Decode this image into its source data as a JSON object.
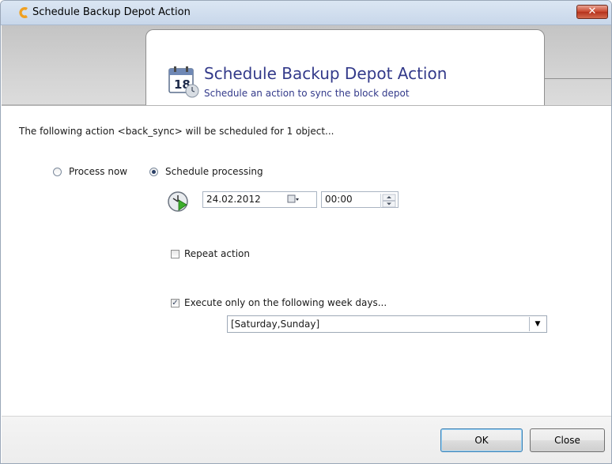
{
  "window": {
    "title": "Schedule Backup Depot Action",
    "close_glyph": "✕"
  },
  "header": {
    "title": "Schedule Backup Depot Action",
    "subtitle": "Schedule an action to sync the block depot",
    "icon_day": "18",
    "icon_name": "calendar-clock-icon"
  },
  "info": {
    "text": "The following action <back_sync> will be scheduled for 1 object..."
  },
  "processing": {
    "options": [
      {
        "label": "Process now",
        "selected": false
      },
      {
        "label": "Schedule processing",
        "selected": true
      }
    ],
    "date": "24.02.2012",
    "time": "00:00"
  },
  "repeat": {
    "label": "Repeat action",
    "checked": false
  },
  "weekdays": {
    "label": "Execute only on the following week days...",
    "checked": true,
    "value": "[Saturday,Sunday]"
  },
  "footer": {
    "ok_label": "OK",
    "close_label": "Close"
  },
  "colors": {
    "header_text": "#333a8a",
    "close_button": "#c8452c"
  }
}
